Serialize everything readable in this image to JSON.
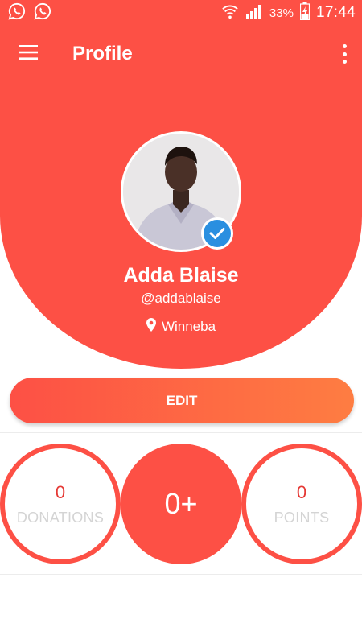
{
  "status_bar": {
    "battery": "33%",
    "time": "17:44",
    "icons": [
      "whatsapp-icon",
      "whatsapp-icon",
      "wifi-icon",
      "signal-icon",
      "battery-charging-icon"
    ]
  },
  "appbar": {
    "title": "Profile",
    "menu_icon": "hamburger-menu-icon",
    "more_icon": "more-vertical-icon"
  },
  "profile": {
    "name": "Adda Blaise",
    "handle": "@addablaise",
    "location": "Winneba",
    "verified": true
  },
  "actions": {
    "edit_label": "EDIT"
  },
  "stats": {
    "donations_value": "0",
    "donations_label": "DONATIONS",
    "center_value": "0+",
    "points_value": "0",
    "points_label": "POINTS"
  },
  "colors": {
    "primary": "#fd5045",
    "gradient_end": "#fe7d42",
    "verified_blue": "#2a8fe0",
    "stat_value": "#e53935",
    "stat_label": "#d4d4d4"
  }
}
